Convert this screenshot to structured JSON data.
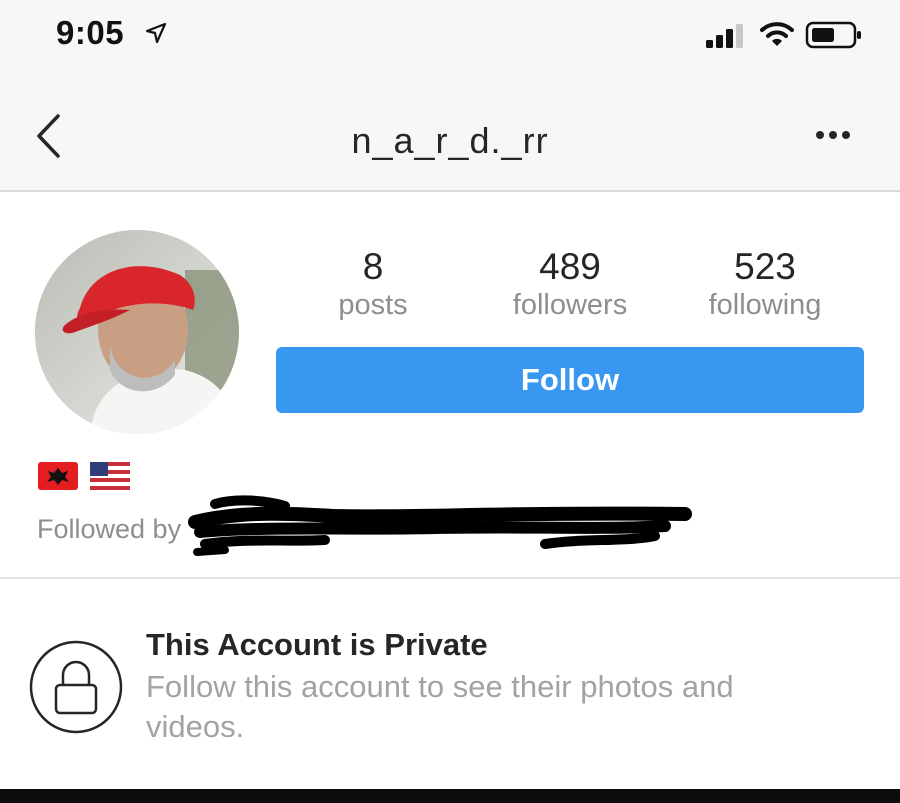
{
  "status_bar": {
    "time": "9:05",
    "icons": [
      "location-arrow-icon",
      "cellular-signal-icon",
      "wifi-icon",
      "battery-icon"
    ]
  },
  "nav": {
    "title": "n_a_r_d._rr",
    "back_icon": "chevron-left-icon",
    "more_icon": "ellipsis-icon"
  },
  "profile": {
    "stats": {
      "posts": {
        "value": "8",
        "label": "posts"
      },
      "followers": {
        "value": "489",
        "label": "followers"
      },
      "following": {
        "value": "523",
        "label": "following"
      }
    },
    "follow_button": "Follow",
    "bio_flags": [
      "albania-flag",
      "usa-flag"
    ],
    "followed_by_label": "Followed by"
  },
  "private_notice": {
    "icon": "lock-icon",
    "title": "This Account is Private",
    "text": "Follow this account to see their photos and videos."
  },
  "colors": {
    "accent": "#3897f0",
    "muted_text": "#8e8e8e",
    "primary_text": "#262626"
  }
}
